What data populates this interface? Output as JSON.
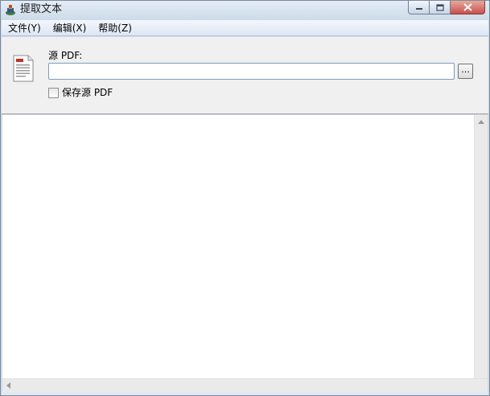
{
  "window": {
    "title": "提取文本",
    "icons": {
      "app": "app-icon",
      "minimize": "minimize-icon",
      "maximize": "maximize-icon",
      "close": "close-icon"
    }
  },
  "menubar": {
    "items": [
      {
        "label": "文件(Y)"
      },
      {
        "label": "编辑(X)"
      },
      {
        "label": "帮助(Z)"
      }
    ]
  },
  "source": {
    "label": "源 PDF:",
    "input_value": "",
    "browse_label": "...",
    "icon": "pdf-document-icon"
  },
  "save_source": {
    "label": "保存源 PDF",
    "checked": false
  },
  "output": {
    "text": ""
  },
  "colors": {
    "close_button": "#c75050",
    "input_border": "#7f9db9"
  }
}
